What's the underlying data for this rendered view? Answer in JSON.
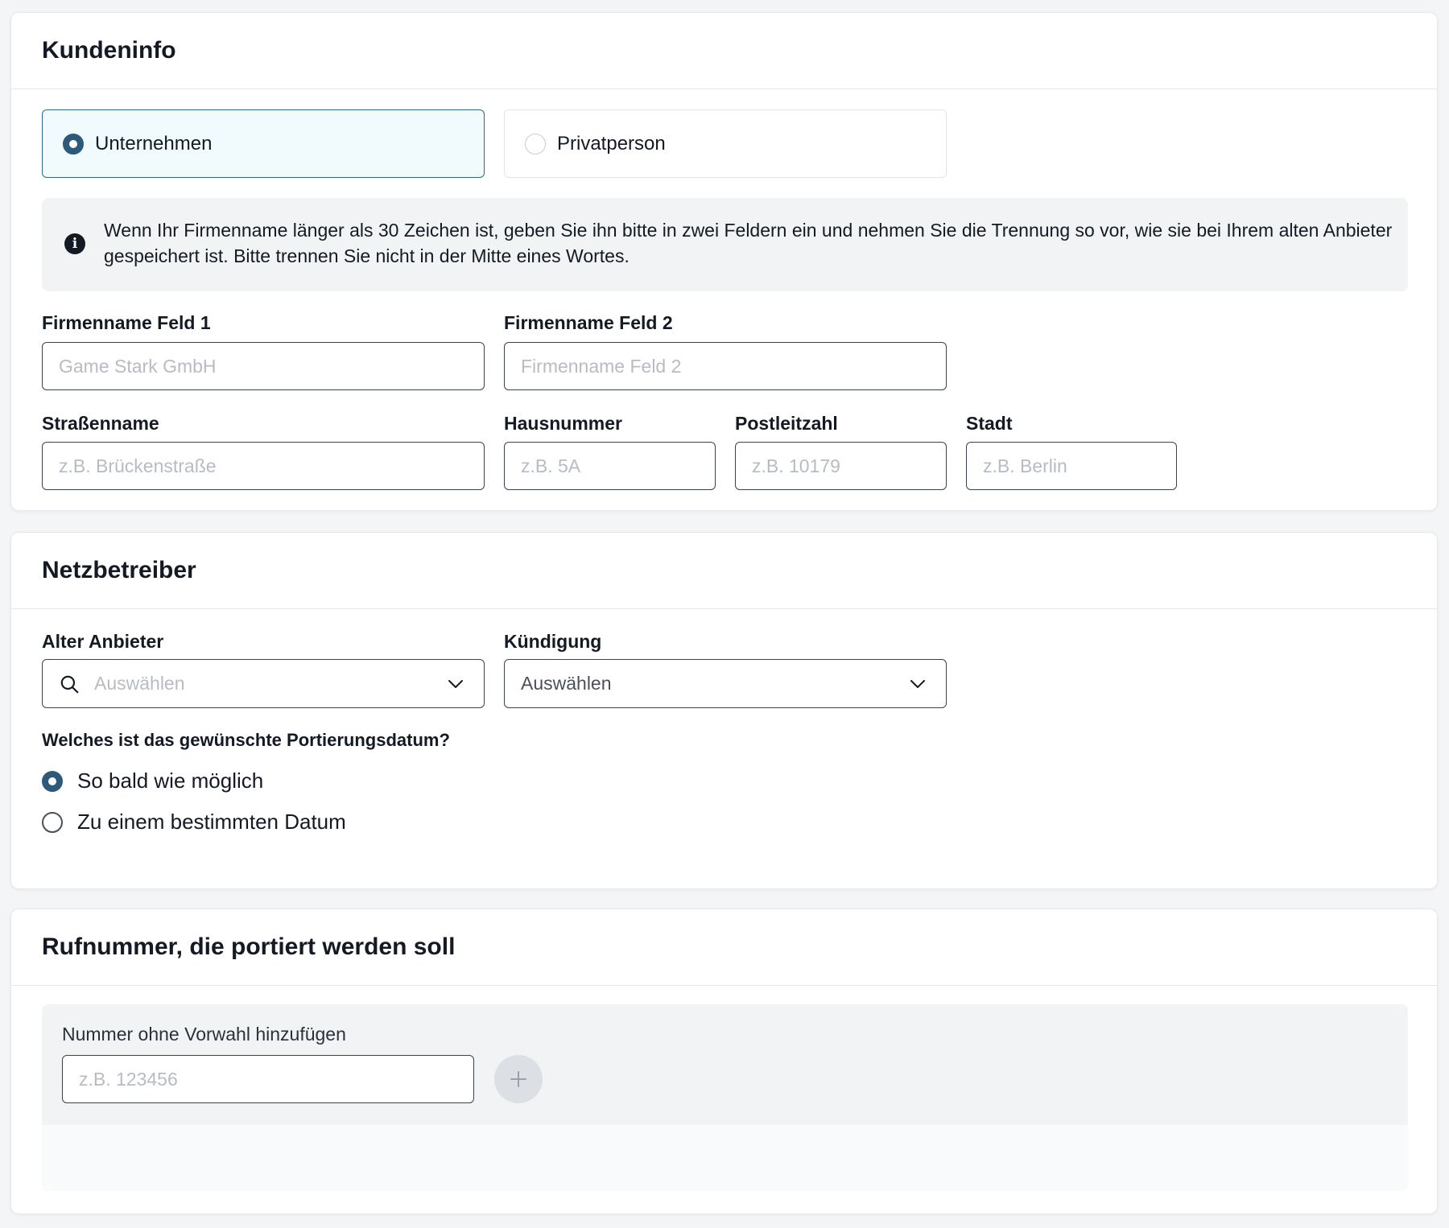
{
  "customer_info": {
    "title": "Kundeninfo",
    "type_options": [
      {
        "label": "Unternehmen",
        "selected": true
      },
      {
        "label": "Privatperson",
        "selected": false
      }
    ],
    "info_text": "Wenn Ihr Firmenname länger als 30 Zeichen ist, geben Sie ihn bitte in zwei Feldern ein und nehmen Sie die Trennung so vor, wie sie bei Ihrem alten Anbieter gespeichert ist. Bitte trennen Sie nicht in der Mitte eines Wortes.",
    "fields": {
      "company1": {
        "label": "Firmenname Feld 1",
        "placeholder": "Game Stark GmbH"
      },
      "company2": {
        "label": "Firmenname Feld 2",
        "placeholder": "Firmenname Feld 2"
      },
      "street": {
        "label": "Straßenname",
        "placeholder": "z.B. Brückenstraße"
      },
      "house_number": {
        "label": "Hausnummer",
        "placeholder": "z.B. 5A"
      },
      "postal_code": {
        "label": "Postleitzahl",
        "placeholder": "z.B. 10179"
      },
      "city": {
        "label": "Stadt",
        "placeholder": "z.B. Berlin"
      }
    }
  },
  "network_operator": {
    "title": "Netzbetreiber",
    "old_provider": {
      "label": "Alter Anbieter",
      "placeholder": "Auswählen"
    },
    "cancellation": {
      "label": "Kündigung",
      "value": "Auswählen"
    },
    "porting_question": "Welches ist das gewünschte Portierungsdatum?",
    "porting_options": [
      {
        "label": "So bald wie möglich",
        "selected": true
      },
      {
        "label": "Zu einem bestimmten Datum",
        "selected": false
      }
    ]
  },
  "phone_number": {
    "title": "Rufnummer, die portiert werden soll",
    "add_label": "Nummer ohne Vorwahl hinzufügen",
    "placeholder": "z.B. 123456"
  },
  "icons": {
    "info": "info-icon",
    "search": "search-icon",
    "chevron": "chevron-down-icon",
    "add": "plus-icon"
  },
  "colors": {
    "accent": "#2d5a7a",
    "selected_bg": "#f1fafd",
    "info_bg": "#f2f3f5"
  }
}
